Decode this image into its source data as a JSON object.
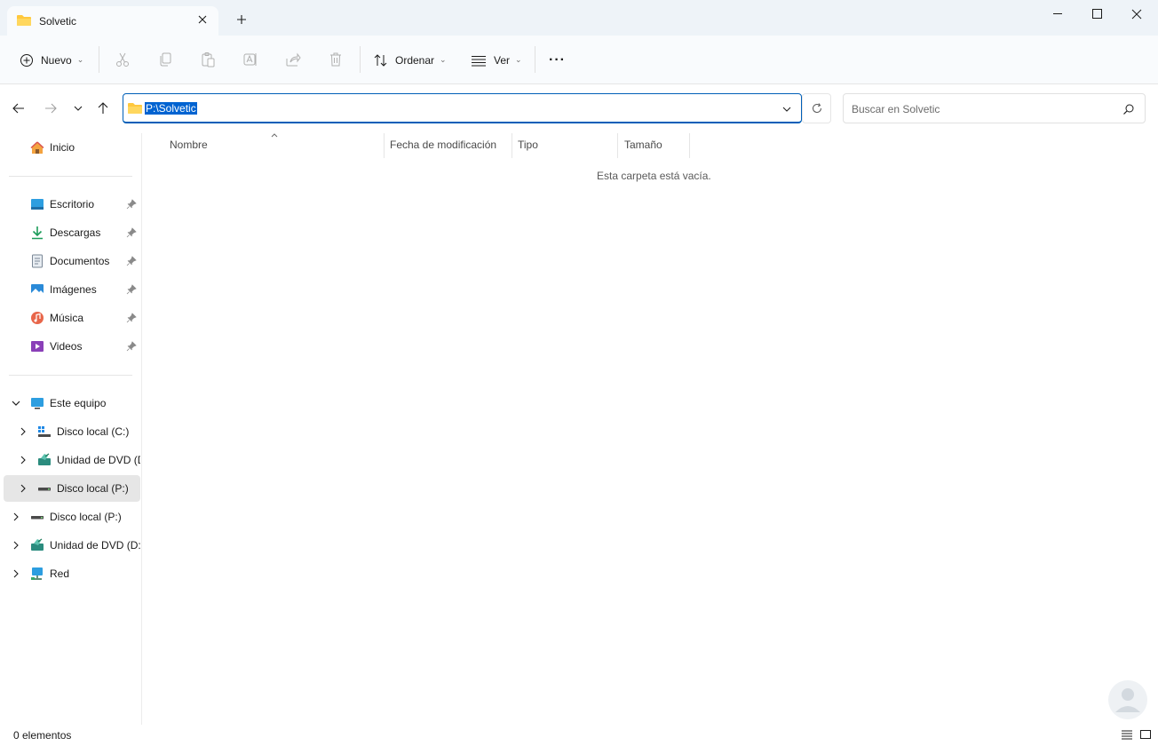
{
  "tab": {
    "title": "Solvetic"
  },
  "toolbar": {
    "new_label": "Nuevo",
    "sort_label": "Ordenar",
    "view_label": "Ver",
    "more_label": "···"
  },
  "address": {
    "path": "P:\\Solvetic",
    "search_placeholder": "Buscar en Solvetic"
  },
  "sidebar": {
    "home": "Inicio",
    "quick_access": [
      {
        "label": "Escritorio",
        "icon": "desktop-icon"
      },
      {
        "label": "Descargas",
        "icon": "download-icon"
      },
      {
        "label": "Documentos",
        "icon": "documents-icon"
      },
      {
        "label": "Imágenes",
        "icon": "pictures-icon"
      },
      {
        "label": "Música",
        "icon": "music-icon"
      },
      {
        "label": "Videos",
        "icon": "videos-icon"
      }
    ],
    "this_pc": "Este equipo",
    "this_pc_children": [
      {
        "label": "Disco local (C:)"
      },
      {
        "label": "Unidad de DVD (D"
      },
      {
        "label": "Disco local (P:)"
      }
    ],
    "root_items": [
      {
        "label": "Disco local (P:)"
      },
      {
        "label": "Unidad de DVD (D:)"
      },
      {
        "label": "Red"
      }
    ]
  },
  "content": {
    "columns": [
      "Nombre",
      "Fecha de modificación",
      "Tipo",
      "Tamaño"
    ],
    "empty_message": "Esta carpeta está vacía."
  },
  "status": {
    "items_count": "0 elementos"
  },
  "colors": {
    "accent": "#0063d1",
    "folder": "#ffc83d",
    "selection": "#e6e6e6"
  }
}
